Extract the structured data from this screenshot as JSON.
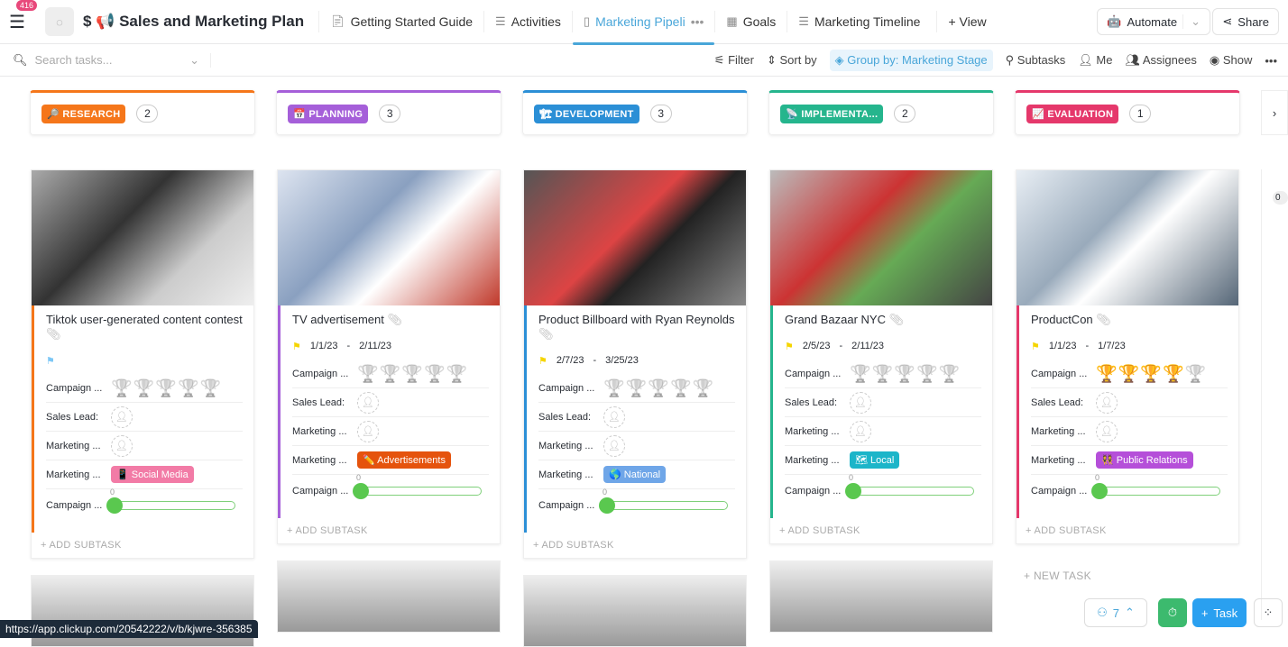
{
  "header": {
    "notifications": "416",
    "title": "$ 📢 Sales and Marketing Plan",
    "tabs": [
      {
        "label": "Getting Started Guide",
        "icon": "doc-icon"
      },
      {
        "label": "Activities",
        "icon": "list-icon"
      },
      {
        "label": "Marketing Pipeli",
        "icon": "board-icon",
        "active": true
      },
      {
        "label": "Goals",
        "icon": "table-icon"
      },
      {
        "label": "Marketing Timeline",
        "icon": "gantt-icon"
      }
    ],
    "add_view": "+ View",
    "automate": "Automate",
    "share": "Share"
  },
  "toolbar": {
    "search_placeholder": "Search tasks...",
    "filter": "Filter",
    "sort": "Sort by",
    "group": "Group by: Marketing Stage",
    "subtasks": "Subtasks",
    "me": "Me",
    "assignees": "Assignees",
    "show": "Show"
  },
  "columns": [
    {
      "name": "🔎 RESEARCH",
      "count": "2",
      "color": "#f5761a",
      "card": {
        "title": "Tiktok user-generated content contest",
        "flag": "#7cc7f5",
        "dates": null,
        "rating": 0,
        "tag": "📱 Social Media",
        "tag_color": "#f27ba6",
        "progress": 0,
        "img": "linear-gradient(135deg,#aaa,#333 40%,#ccc 70%,#eee)"
      }
    },
    {
      "name": "📅 PLANNING",
      "count": "3",
      "color": "#a55fd9",
      "card": {
        "title": "TV advertisement",
        "flag": "#f5d500",
        "dates": [
          "1/1/23",
          "2/11/23"
        ],
        "rating": 0,
        "tag": "✏️ Advertisements",
        "tag_color": "#e5530d",
        "progress": 0,
        "img": "linear-gradient(135deg,#dde4f0,#8aa0c0 40%,#fff 60%,#c0392b)"
      }
    },
    {
      "name": "🏗 DEVELOPMENT",
      "count": "3",
      "color": "#2b8fd6",
      "card": {
        "title": "Product Billboard with Ryan Reynolds",
        "flag": "#f5d500",
        "dates": [
          "2/7/23",
          "3/25/23"
        ],
        "rating": 0,
        "tag": "🌎 National",
        "tag_color": "#6fa6e8",
        "progress": 0,
        "img": "linear-gradient(135deg,#555,#d44 45%,#222 60%,#888)"
      }
    },
    {
      "name": "📡 IMPLEMENTA...",
      "count": "2",
      "color": "#25b58d",
      "card": {
        "title": "Grand Bazaar NYC",
        "flag": "#f5d500",
        "dates": [
          "2/5/23",
          "2/11/23"
        ],
        "rating": 0,
        "tag": "🗺 Local",
        "tag_color": "#1cb5c9",
        "progress": 0,
        "img": "linear-gradient(135deg,#bbb,#c33 40%,#6a5 60%,#444)"
      }
    },
    {
      "name": "📈 EVALUATION",
      "count": "1",
      "color": "#e5386b",
      "card": {
        "title": "ProductCon",
        "flag": "#f5d500",
        "dates": [
          "1/1/23",
          "1/7/23"
        ],
        "rating": 4,
        "tag": "👯 Public Relations",
        "tag_color": "#b54fd9",
        "progress": 0,
        "img": "linear-gradient(135deg,#e8eef4,#9ab 40%,#fff 55%,#567)"
      }
    }
  ],
  "labels": {
    "campaign_rating": "Campaign ...",
    "sales_lead": "Sales Lead:",
    "marketing_owner": "Marketing ...",
    "marketing_channel": "Marketing ...",
    "campaign_progress": "Campaign ...",
    "add_subtask": "+ ADD SUBTASK",
    "new_task": "+ NEW TASK"
  },
  "side_count": "0",
  "status_url": "https://app.clickup.com/20542222/v/b/kjwre-356385",
  "bottom": {
    "notif_count": "7",
    "task": "Task"
  }
}
